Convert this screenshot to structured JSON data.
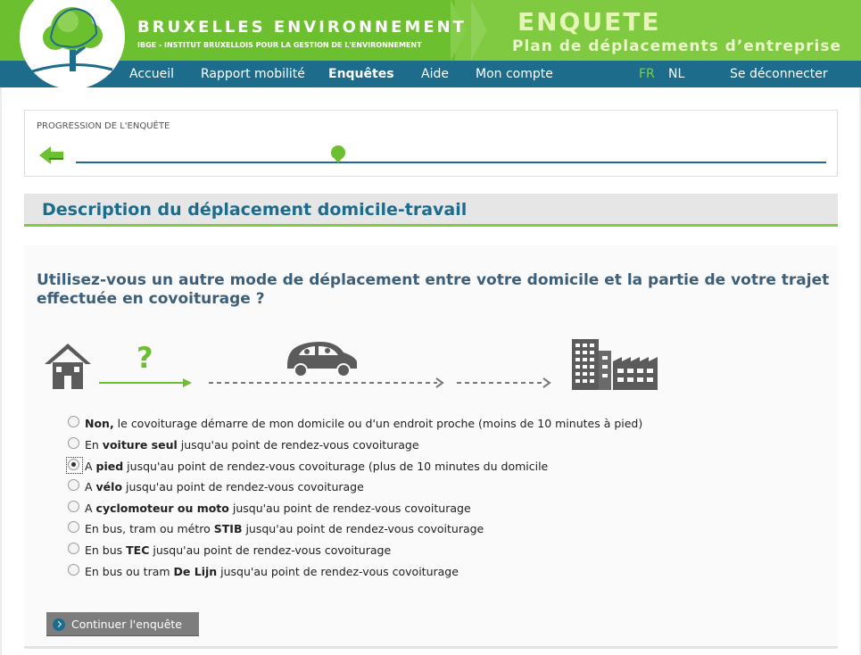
{
  "header": {
    "brand_title": "BRUXELLES ENVIRONNEMENT",
    "brand_subtitle": "IBGE - INSTITUT BRUXELLOIS POUR LA GESTION DE L'ENVIRONNEMENT",
    "survey_title": "ENQUETE",
    "survey_subtitle": "Plan de déplacements d’entreprise",
    "logo_icon": "tree-icon",
    "colors": {
      "green": "#6cbf2f",
      "green_light": "#7fca41",
      "blue": "#1d6c8c"
    }
  },
  "nav": {
    "items": [
      {
        "label": "Accueil"
      },
      {
        "label": "Rapport mobilité"
      },
      {
        "label": "Enquêtes",
        "active": true
      },
      {
        "label": "Aide"
      },
      {
        "label": "Mon compte"
      }
    ],
    "lang_fr": "FR",
    "lang_nl": "NL",
    "logout": "Se déconnecter"
  },
  "progress": {
    "label": "PROGRESSION DE L'ENQUÊTE",
    "back_icon": "arrow-left-icon",
    "marker_icon": "progress-pin-icon",
    "fraction": 0.35
  },
  "section": {
    "title": "Description du déplacement domicile-travail"
  },
  "question": {
    "text": "Utilisez-vous un autre mode de déplacement entre votre domicile et la partie de votre trajet effectuée en covoiturage ?",
    "illustration": {
      "question_mark": "?",
      "icons": [
        "house-icon",
        "question-mark-icon",
        "car-icon",
        "office-building-icon"
      ]
    },
    "options": [
      {
        "bold": "Non,",
        "rest": " le covoiturage démarre de mon domicile ou d'un endroit proche (moins de 10 minutes à pied)",
        "checked": false
      },
      {
        "pre": "En ",
        "bold": "voiture seul",
        "rest": " jusqu'au point de rendez-vous covoiturage",
        "checked": false
      },
      {
        "pre": "A ",
        "bold": "pied",
        "rest": " jusqu'au point de rendez-vous covoiturage (plus de 10 minutes du domicile",
        "checked": true
      },
      {
        "pre": "A ",
        "bold": "vélo",
        "rest": " jusqu'au point de rendez-vous covoiturage",
        "checked": false
      },
      {
        "pre": "A ",
        "bold": "cyclomoteur ou moto",
        "rest": " jusqu'au point de rendez-vous covoiturage",
        "checked": false
      },
      {
        "pre": "En bus, tram ou métro ",
        "bold": "STIB",
        "rest": " jusqu'au point de rendez-vous covoiturage",
        "checked": false
      },
      {
        "pre": "En bus ",
        "bold": "TEC",
        "rest": " jusqu'au point de rendez-vous covoiturage",
        "checked": false
      },
      {
        "pre": "En bus ou tram ",
        "bold": "De Lijn",
        "rest": " jusqu'au point de rendez-vous covoiturage",
        "checked": false
      }
    ]
  },
  "continue_button": {
    "label": "Continuer l'enquête",
    "icon": "chevron-right-circle-icon"
  }
}
